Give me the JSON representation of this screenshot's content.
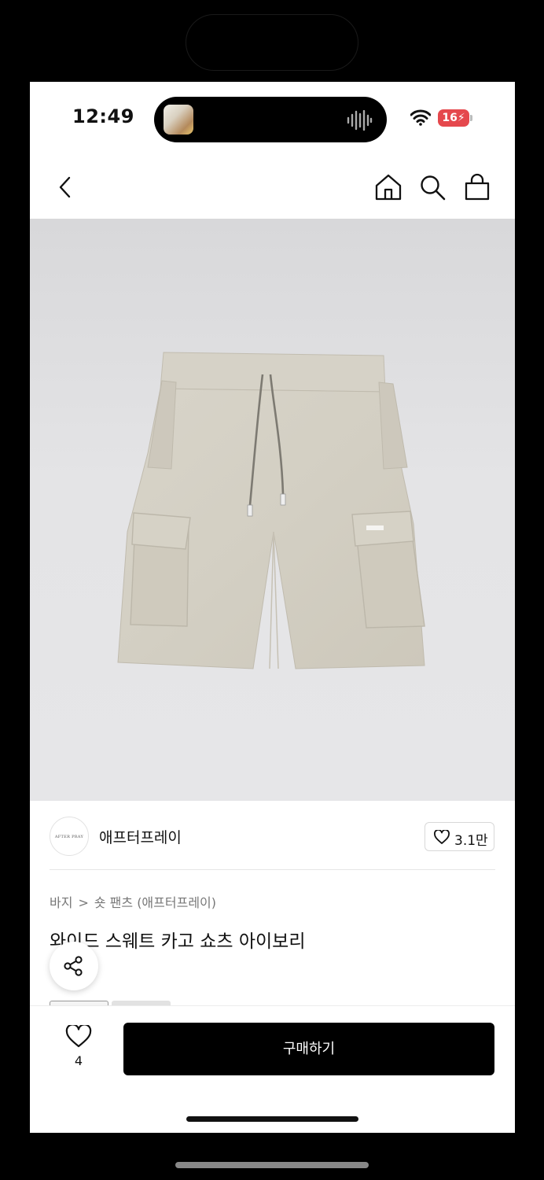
{
  "status_bar": {
    "time": "12:49",
    "battery_level": "16",
    "battery_color": "#e5484d"
  },
  "nav": {
    "icons": [
      "back-icon",
      "home-icon",
      "search-icon",
      "shopping-bag-icon"
    ]
  },
  "hero": {
    "image": "beige wide sweat cargo shorts with drawstring",
    "background": "#e4e4e6",
    "product_color": "#d6d2c7"
  },
  "brand": {
    "logo_text": "AFTER PRAY",
    "name": "애프터프레이",
    "like_count": "3.1만"
  },
  "breadcrumb": {
    "category": "바지",
    "separator": ">",
    "subcategory": "숏 팬츠 (애프터프레이)"
  },
  "product": {
    "title": "와이드 스웨트 카고 쇼츠 아이보리"
  },
  "action_bar": {
    "wish_count": "4",
    "buy_label": "구매하기"
  }
}
